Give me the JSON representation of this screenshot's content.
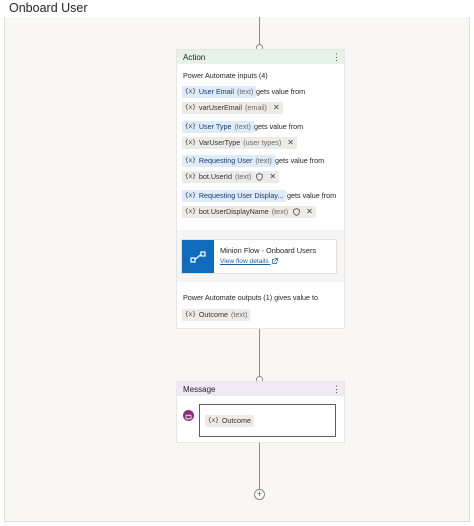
{
  "page": {
    "title": "Onboard User"
  },
  "action": {
    "header": "Action",
    "inputs_label": "Power Automate inputs (4)",
    "var_prefix": "{x}",
    "inputs": [
      {
        "param": "User Email",
        "param_type": "(text)",
        "gets": "gets value from",
        "value": "varUserEmail",
        "value_type": "(email)"
      },
      {
        "param": "User Type",
        "param_type": "(text)",
        "gets": "gets value from",
        "value": "VarUserType",
        "value_type": "(user types)"
      },
      {
        "param": "Requesting User",
        "param_type": "(text)",
        "gets": "gets value from",
        "value": "bot.UserId",
        "value_type": "(text)"
      },
      {
        "param": "Requesting User Display...",
        "param_type": "",
        "gets": "gets value from",
        "value": "bot.UserDisplayName",
        "value_type": "(text)"
      }
    ],
    "flow": {
      "name": "Minion Flow - Onboard Users",
      "link": "View flow details"
    },
    "outputs_label": "Power Automate outputs (1) gives value to",
    "output": {
      "name": "Outcome",
      "type": "(text)"
    }
  },
  "message": {
    "header": "Message",
    "var_prefix": "{x}",
    "content": "Outcome"
  },
  "colors": {
    "action_header": "#e6f2e5",
    "message_header": "#efe9f3",
    "flow_icon": "#0f6cbd",
    "chip_blue": "#deecf9",
    "chip_gray": "#edebe9",
    "link": "#115ea3",
    "chat_icon": "#8b2f7a"
  },
  "icons": {
    "kebab": "⋮",
    "close": "✕",
    "plus": "+",
    "open_external": "external-link-icon",
    "shield": "shield-icon",
    "flow": "power-automate-flow-icon",
    "chat": "chat-bubble-icon"
  }
}
